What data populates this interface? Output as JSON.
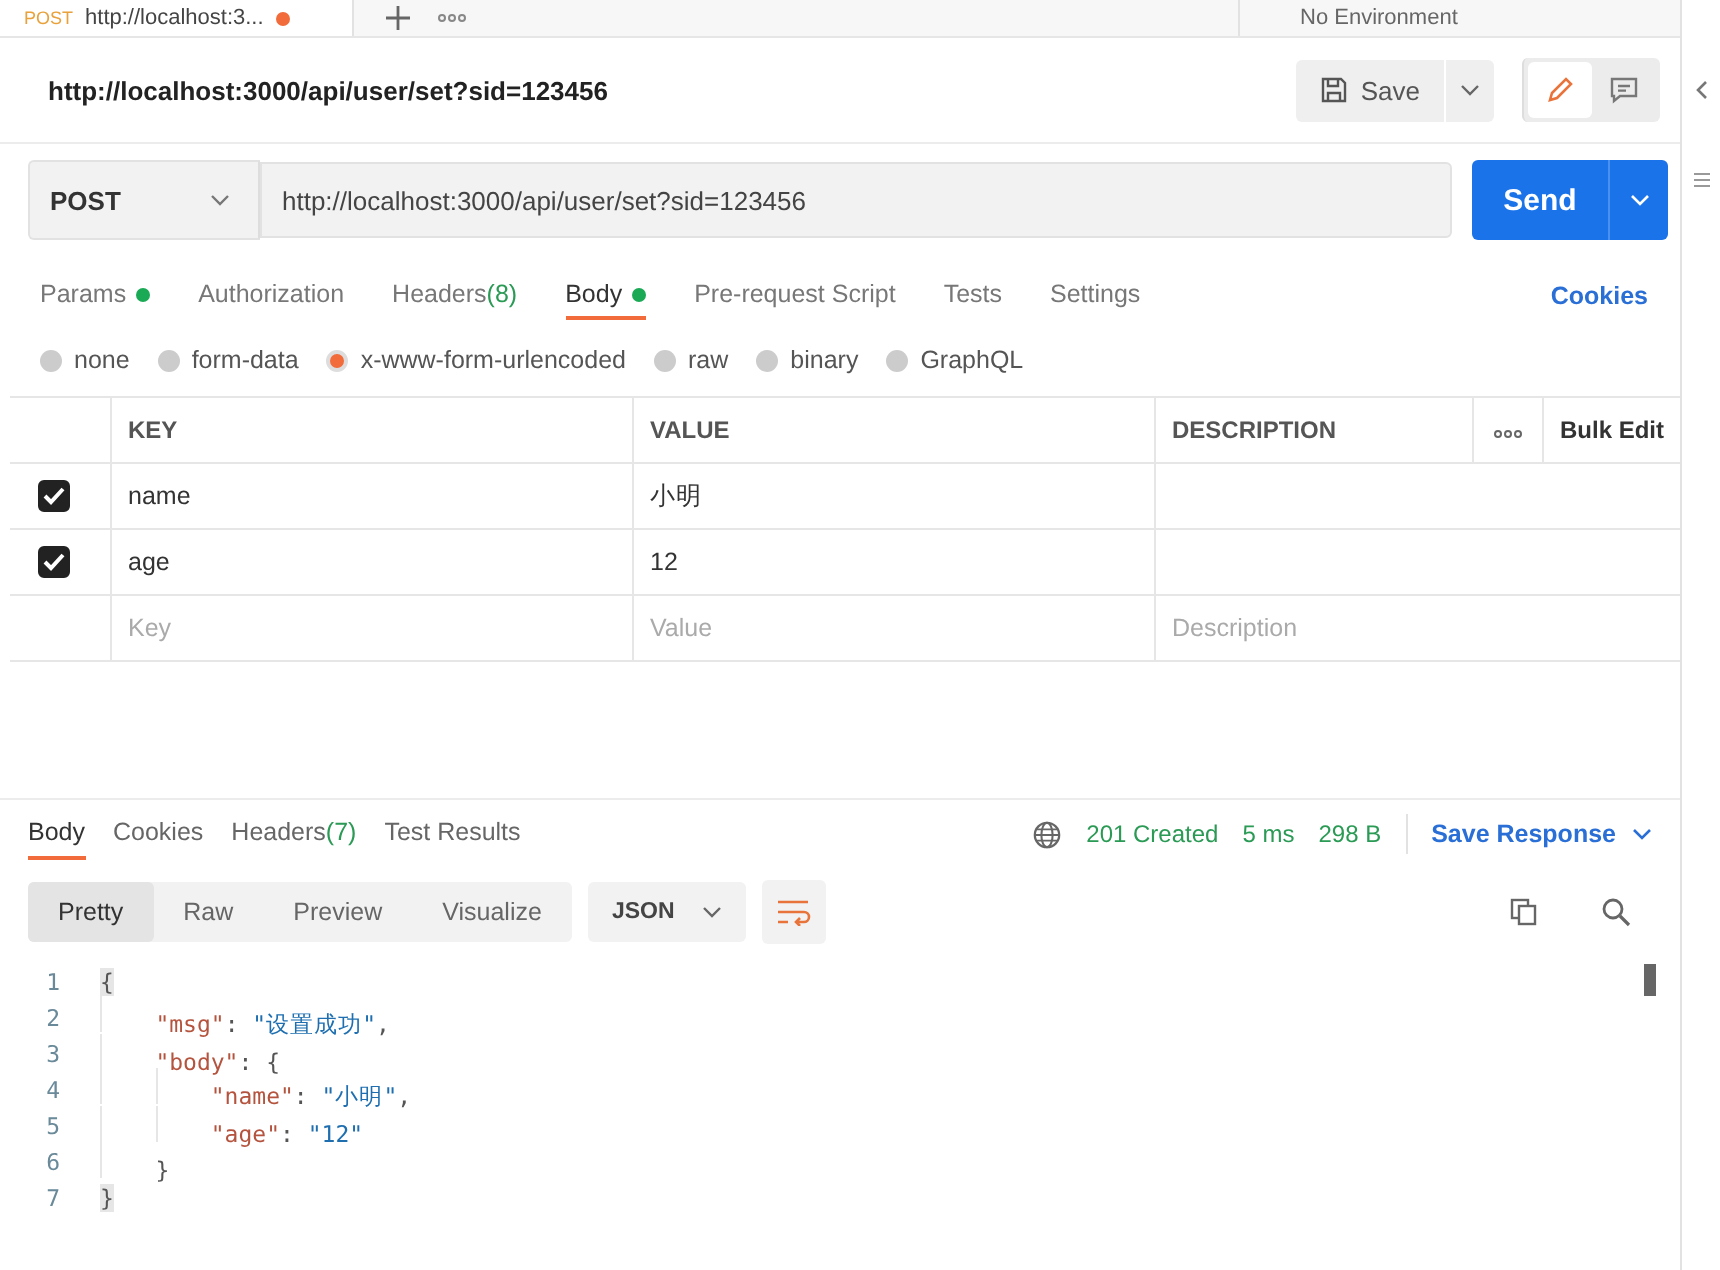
{
  "top_tab": {
    "method": "POST",
    "title": "http://localhost:3...",
    "unsaved": true
  },
  "environment": {
    "label": "No Environment"
  },
  "request": {
    "title": "http://localhost:3000/api/user/set?sid=123456",
    "save_label": "Save",
    "method": "POST",
    "url": "http://localhost:3000/api/user/set?sid=123456",
    "send_label": "Send"
  },
  "request_tabs": [
    {
      "label": "Params",
      "dot": true,
      "selected": false
    },
    {
      "label": "Authorization",
      "dot": false,
      "selected": false
    },
    {
      "label": "Headers",
      "count": "(8)",
      "dot": false,
      "selected": false
    },
    {
      "label": "Body",
      "dot": true,
      "selected": true
    },
    {
      "label": "Pre-request Script",
      "dot": false,
      "selected": false
    },
    {
      "label": "Tests",
      "dot": false,
      "selected": false
    },
    {
      "label": "Settings",
      "dot": false,
      "selected": false
    }
  ],
  "cookies_link": "Cookies",
  "body_types": [
    {
      "label": "none",
      "selected": false
    },
    {
      "label": "form-data",
      "selected": false
    },
    {
      "label": "x-www-form-urlencoded",
      "selected": true
    },
    {
      "label": "raw",
      "selected": false
    },
    {
      "label": "binary",
      "selected": false
    },
    {
      "label": "GraphQL",
      "selected": false
    }
  ],
  "table": {
    "columns": [
      "KEY",
      "VALUE",
      "DESCRIPTION"
    ],
    "bulk_edit": "Bulk Edit",
    "rows": [
      {
        "checked": true,
        "key": "name",
        "value": "小明"
      },
      {
        "checked": true,
        "key": "age",
        "value": "12"
      }
    ],
    "new_row": {
      "key_placeholder": "Key",
      "value_placeholder": "Value",
      "description_placeholder": "Description"
    }
  },
  "response_tabs": [
    {
      "label": "Body",
      "selected": true
    },
    {
      "label": "Cookies",
      "selected": false
    },
    {
      "label": "Headers",
      "count": "(7)",
      "selected": false
    },
    {
      "label": "Test Results",
      "selected": false
    }
  ],
  "status": {
    "code": "201 Created",
    "time": "5 ms",
    "size": "298 B",
    "save_response": "Save Response"
  },
  "view_modes": [
    {
      "label": "Pretty",
      "selected": true
    },
    {
      "label": "Raw",
      "selected": false
    },
    {
      "label": "Preview",
      "selected": false
    },
    {
      "label": "Visualize",
      "selected": false
    }
  ],
  "format": "JSON",
  "code_lines": [
    {
      "number": "1",
      "tokens": [
        {
          "kind": "brace",
          "text": "{"
        }
      ]
    },
    {
      "number": "2",
      "tokens": [
        {
          "kind": "indent"
        },
        {
          "kind": "key",
          "text": "\"msg\""
        },
        {
          "kind": "punct",
          "text": ": "
        },
        {
          "kind": "string",
          "text": "\"设置成功\""
        },
        {
          "kind": "punct",
          "text": ","
        }
      ]
    },
    {
      "number": "3",
      "tokens": [
        {
          "kind": "indent"
        },
        {
          "kind": "key",
          "text": "\"body\""
        },
        {
          "kind": "punct",
          "text": ": {"
        }
      ]
    },
    {
      "number": "4",
      "tokens": [
        {
          "kind": "indent"
        },
        {
          "kind": "indent"
        },
        {
          "kind": "key",
          "text": "\"name\""
        },
        {
          "kind": "punct",
          "text": ": "
        },
        {
          "kind": "string",
          "text": "\"小明\""
        },
        {
          "kind": "punct",
          "text": ","
        }
      ]
    },
    {
      "number": "5",
      "tokens": [
        {
          "kind": "indent"
        },
        {
          "kind": "indent"
        },
        {
          "kind": "key",
          "text": "\"age\""
        },
        {
          "kind": "punct",
          "text": ": "
        },
        {
          "kind": "string",
          "text": "\"12\""
        }
      ]
    },
    {
      "number": "6",
      "tokens": [
        {
          "kind": "indent"
        },
        {
          "kind": "punct",
          "text": "}"
        }
      ]
    },
    {
      "number": "7",
      "tokens": [
        {
          "kind": "brace",
          "text": "}"
        }
      ]
    }
  ]
}
